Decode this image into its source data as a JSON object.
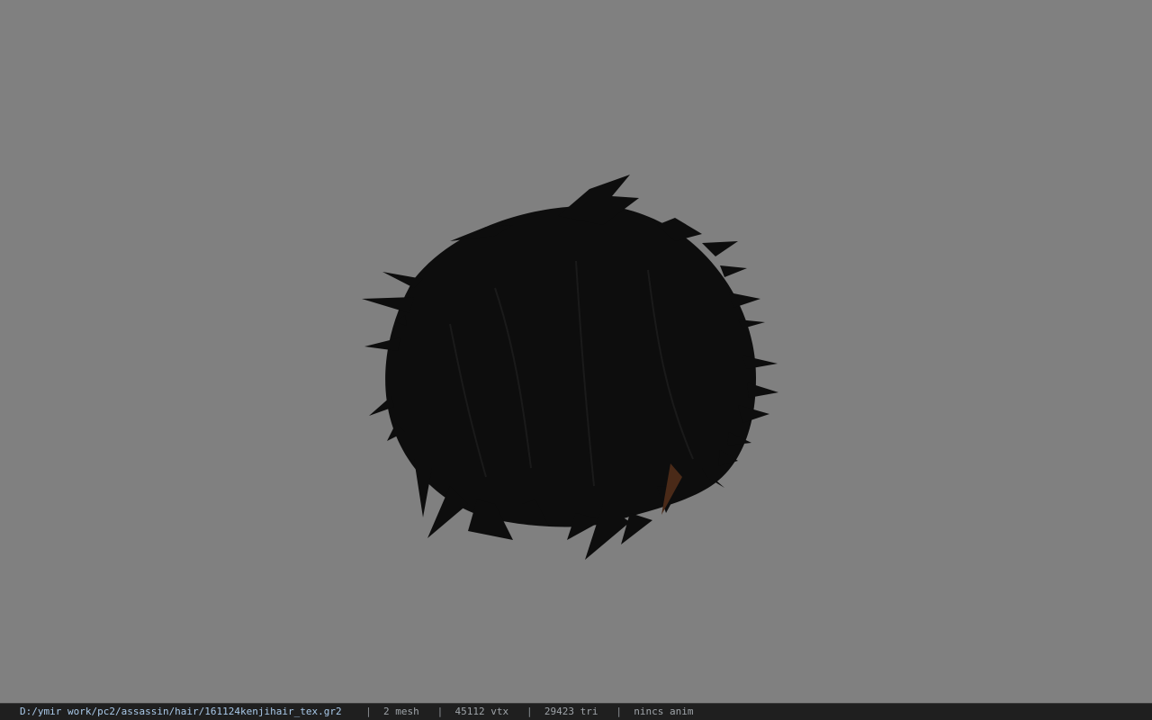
{
  "viewport": {
    "background_color": "#808080",
    "model_icon": "hair-mesh"
  },
  "status_bar": {
    "file_path": "D:/ymir work/pc2/assassin/hair/161124kenjihair_tex.gr2",
    "mesh_count": "2 mesh",
    "vertex_count": "45112 vtx",
    "triangle_count": "29423 tri",
    "animation_status": "nincs anim",
    "separator": "|"
  }
}
